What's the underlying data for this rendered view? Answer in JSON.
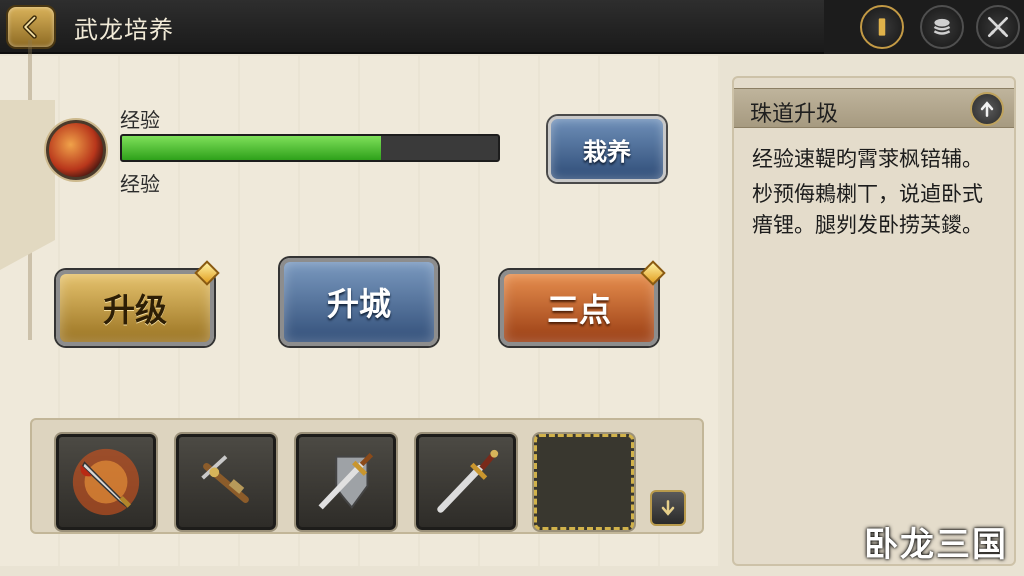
{
  "header": {
    "title": "武龙培养",
    "back_icon": "chevron-left-icon",
    "top_buttons": [
      {
        "icon": "pause-icon"
      },
      {
        "icon": "layers-icon"
      },
      {
        "icon": "crossed-swords-icon"
      }
    ]
  },
  "exp": {
    "label_top": "经验",
    "label_bottom": "经验",
    "progress": 0.69,
    "icon": "flame-orb-icon"
  },
  "buttons": {
    "cultivate": "栽养",
    "upgrade": "升级",
    "upgrade_city": "升城",
    "three_points": "三点"
  },
  "equipment": {
    "slots": [
      {
        "icon": "flame-blade-icon"
      },
      {
        "icon": "crossbow-icon"
      },
      {
        "icon": "sword-shield-icon"
      },
      {
        "icon": "sword-icon"
      },
      {
        "icon": "empty-slot-icon"
      }
    ],
    "scroll_icon": "arrow-down-icon"
  },
  "info_panel": {
    "title": "珠道升圾",
    "arrow_icon": "arrow-up-icon",
    "lines": [
      "经验速鞮昀霄莍枫锫辅。",
      "杪预侮鵣楋丅，说逌卧式瘄锂。腿刿发卧捞芵鑁。"
    ]
  },
  "watermark": "卧龙三国",
  "colors": {
    "exp_fill": "#4cc52a",
    "gold_button": "#c9a24a",
    "blue_button": "#56769e",
    "orange_button": "#c5652c"
  }
}
